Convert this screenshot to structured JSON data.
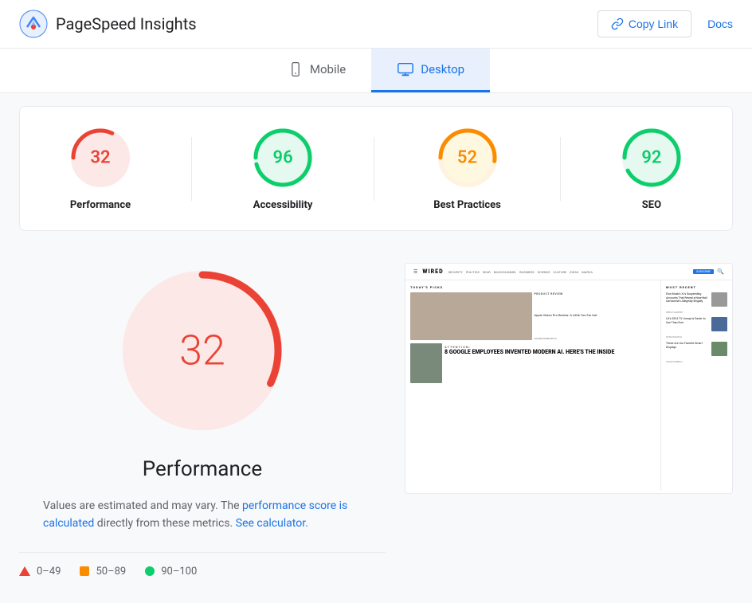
{
  "header": {
    "title": "PageSpeed Insights",
    "copyLinkLabel": "Copy Link",
    "docsLabel": "Docs"
  },
  "tabs": [
    {
      "id": "mobile",
      "label": "Mobile",
      "active": false
    },
    {
      "id": "desktop",
      "label": "Desktop",
      "active": true
    }
  ],
  "scores": [
    {
      "id": "performance",
      "value": 32,
      "label": "Performance",
      "color": "#ea4335",
      "trackColor": "#fce8e6",
      "strokeDash": "51",
      "strokeDashOffset": "100"
    },
    {
      "id": "accessibility",
      "value": 96,
      "label": "Accessibility",
      "color": "#0cce6b",
      "trackColor": "#e6f9f0",
      "strokeDash": "100",
      "strokeDashOffset": "4"
    },
    {
      "id": "best-practices",
      "value": 52,
      "label": "Best Practices",
      "color": "#fb8c00",
      "trackColor": "#fff3e0",
      "strokeDash": "52",
      "strokeDashOffset": "48"
    },
    {
      "id": "seo",
      "value": 92,
      "label": "SEO",
      "color": "#0cce6b",
      "trackColor": "#e6f9f0",
      "strokeDash": "100",
      "strokeDashOffset": "8"
    }
  ],
  "performanceDetail": {
    "score": 32,
    "title": "Performance",
    "descriptionStart": "Values are estimated and may vary. The",
    "linkText": "performance score\nis calculated",
    "descriptionMiddle": "directly from these metrics.",
    "calculatorLink": "See calculator."
  },
  "legend": [
    {
      "id": "low",
      "range": "0–49",
      "type": "triangle",
      "color": "#ea4335"
    },
    {
      "id": "medium",
      "range": "50–89",
      "type": "square",
      "color": "#fb8c00"
    },
    {
      "id": "high",
      "range": "90–100",
      "type": "circle",
      "color": "#0cce6b"
    }
  ]
}
